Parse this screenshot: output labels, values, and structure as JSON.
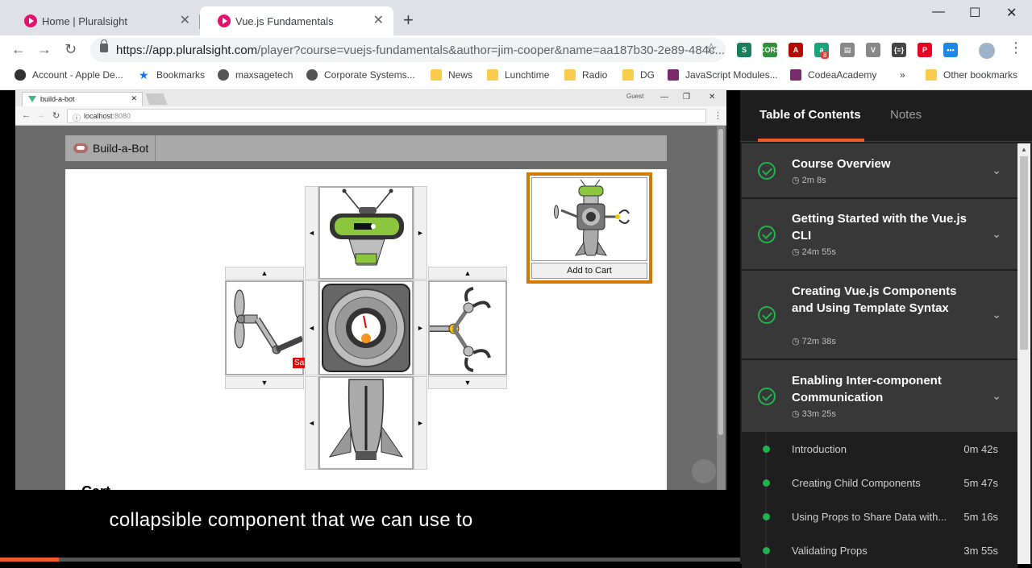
{
  "tabs": [
    {
      "title": "Home | Pluralsight"
    },
    {
      "title": "Vue.js Fundamentals"
    }
  ],
  "window_controls": {
    "minimize": "—",
    "maximize": "☐",
    "close": "✕"
  },
  "address_bar": {
    "host": "https://app.pluralsight.com",
    "path": "/player?course=vuejs-fundamentals&author=jim-cooper&name=aa187b30-2e89-484c..."
  },
  "extensions": [
    {
      "name": "script-extension-icon",
      "label": "S",
      "color": "#1a7f5a"
    },
    {
      "name": "cors-extension-icon",
      "label": "CORS",
      "color": "#2f8f3a"
    },
    {
      "name": "pdf-extension-icon",
      "label": "A",
      "color": "#b30b00"
    },
    {
      "name": "badge-extension-icon",
      "label": "a",
      "color": "#1aa37a",
      "badge": "8"
    },
    {
      "name": "comment-extension-icon",
      "label": "▤",
      "color": "#888888"
    },
    {
      "name": "vue-devtools-icon",
      "label": "V",
      "color": "#888888"
    },
    {
      "name": "json-extension-icon",
      "label": "{≡}",
      "color": "#444444"
    },
    {
      "name": "pinterest-extension-icon",
      "label": "P",
      "color": "#e60023"
    },
    {
      "name": "chat-extension-icon",
      "label": "•••",
      "color": "#1e88e5"
    },
    {
      "name": "profile-avatar-icon",
      "label": "",
      "color": "#9fb3c8"
    }
  ],
  "bookmarks": [
    {
      "label": "Account - Apple De...",
      "icon": "apple-icon"
    },
    {
      "label": "Bookmarks",
      "icon": "star-icon"
    },
    {
      "label": "maxsagetech",
      "icon": "globe-icon"
    },
    {
      "label": "Corporate Systems...",
      "icon": "globe-icon"
    },
    {
      "label": "News",
      "icon": "folder-icon"
    },
    {
      "label": "Lunchtime",
      "icon": "folder-icon"
    },
    {
      "label": "Radio",
      "icon": "folder-icon"
    },
    {
      "label": "DG",
      "icon": "folder-icon"
    },
    {
      "label": "JavaScript Modules...",
      "icon": "site-icon"
    },
    {
      "label": "CodeaAcademy",
      "icon": "site-icon"
    },
    {
      "label": "»",
      "icon": ""
    },
    {
      "label": "Other bookmarks",
      "icon": "folder-icon"
    }
  ],
  "video": {
    "inner_browser": {
      "tab_title": "build-a-bot",
      "url": "localhost",
      "port": ":8080",
      "window_user": "Guest"
    },
    "app": {
      "brand": "Build-a-Bot",
      "sale_label": "Sale!",
      "add_to_cart": "Add to Cart",
      "cart_heading": "Cart",
      "arrows": {
        "up": "▲",
        "down": "▼",
        "left": "◄",
        "right": "►"
      }
    },
    "caption": "collapsible component that we can use to",
    "progress": 0.08
  },
  "sidebar": {
    "tabs": [
      {
        "label": "Table of Contents",
        "active": true
      },
      {
        "label": "Notes",
        "active": false
      }
    ],
    "modules": [
      {
        "title": "Course Overview",
        "duration": "2m 8s",
        "completed": true
      },
      {
        "title": "Getting Started with the Vue.js CLI",
        "duration": "24m 55s",
        "completed": true
      },
      {
        "title": "Creating Vue.js Components and Using Template Syntax",
        "duration": "72m 38s",
        "completed": true
      },
      {
        "title": "Enabling Inter-component Communication",
        "duration": "33m 25s",
        "completed": true
      }
    ],
    "clips": [
      {
        "title": "Introduction",
        "duration": "0m 42s"
      },
      {
        "title": "Creating Child Components",
        "duration": "5m 47s"
      },
      {
        "title": "Using Props to Share Data with...",
        "duration": "5m 16s"
      },
      {
        "title": "Validating Props",
        "duration": "3m 55s"
      }
    ]
  },
  "colors": {
    "accent": "#f15b2a",
    "complete": "#23b14d",
    "preview_border": "#d47800"
  }
}
